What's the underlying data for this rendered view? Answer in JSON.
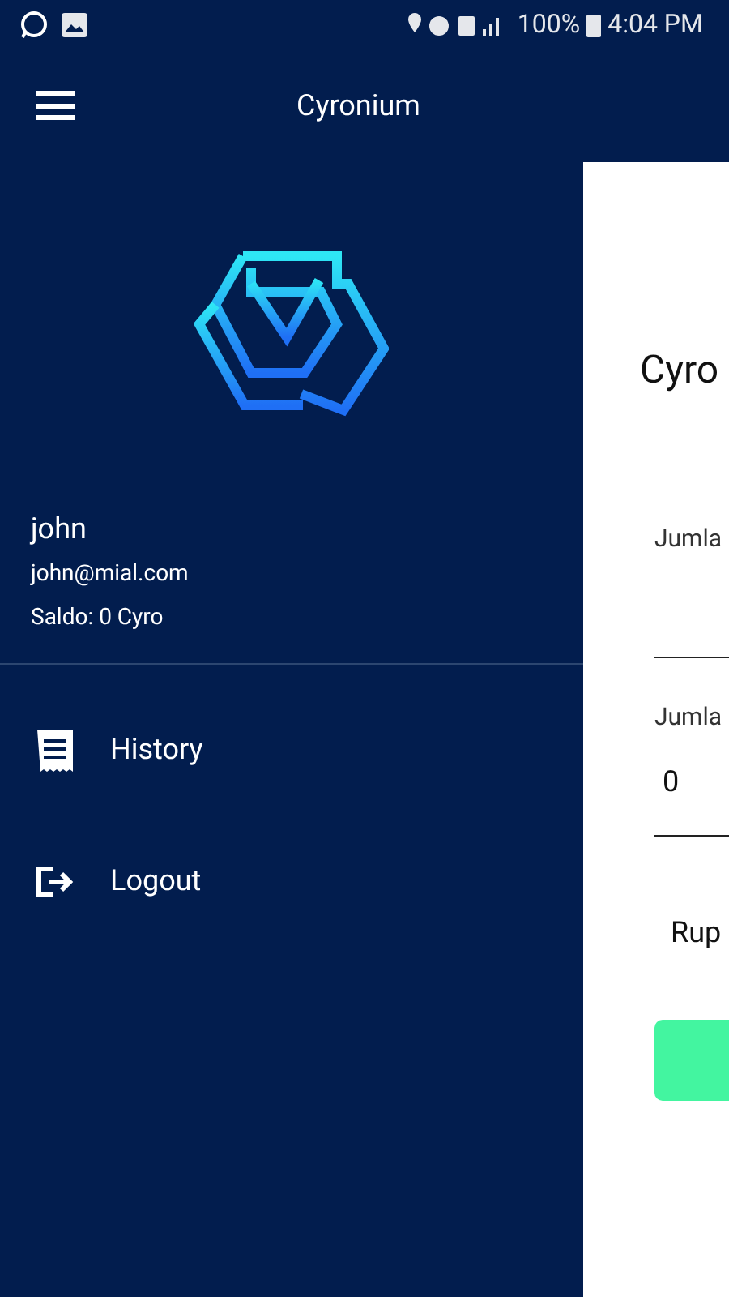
{
  "status_bar": {
    "battery": "100%",
    "time": "4:04 PM"
  },
  "app_bar": {
    "title": "Cyronium"
  },
  "drawer": {
    "user_name": "john",
    "email": "john@mial.com",
    "balance": "Saldo: 0 Cyro",
    "items": [
      {
        "kind": "history",
        "label": "History"
      },
      {
        "kind": "logout",
        "label": "Logout"
      }
    ]
  },
  "page": {
    "heading": "Cyro",
    "fields": [
      {
        "label": "Jumla"
      },
      {
        "label": "Jumla",
        "value": "0"
      }
    ],
    "note": "Rup",
    "button": {
      "kind": "primary"
    }
  }
}
